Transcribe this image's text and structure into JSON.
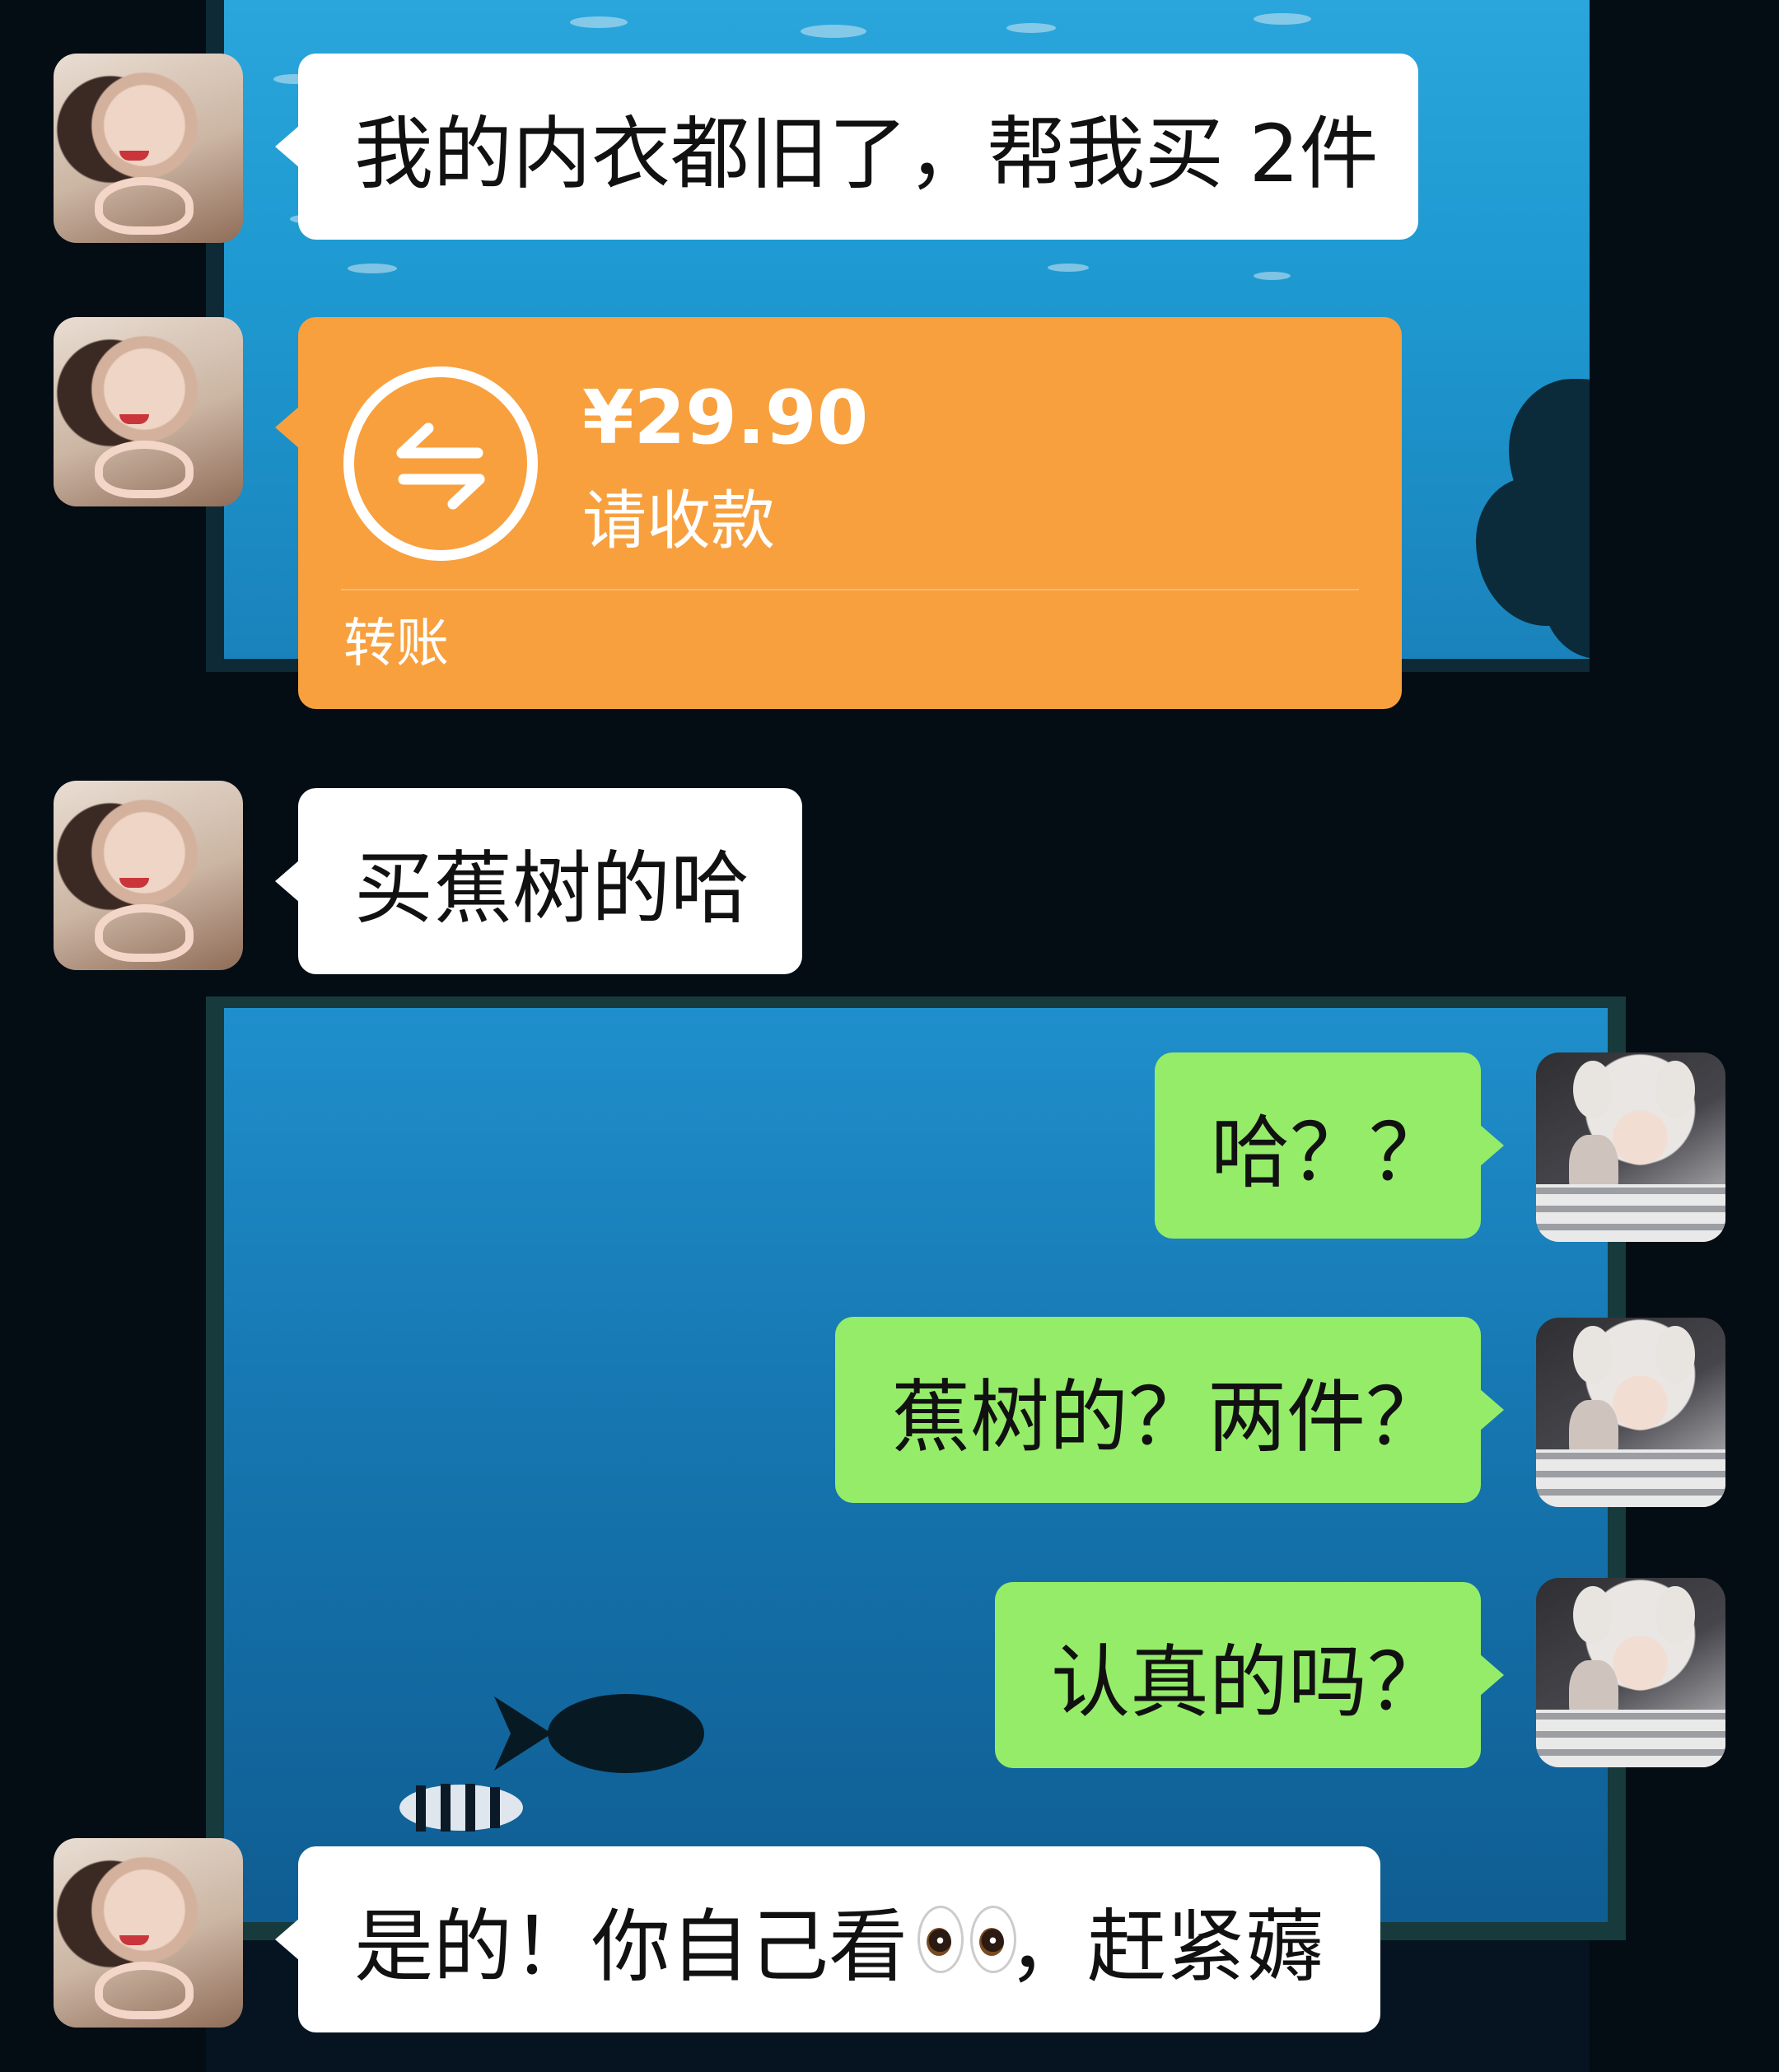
{
  "messages": [
    {
      "id": "m1",
      "side": "left",
      "text": "我的内衣都旧了，帮我买 2件"
    },
    {
      "id": "m2",
      "side": "left",
      "type": "transfer"
    },
    {
      "id": "m3",
      "side": "left",
      "text": "买蕉树的哈"
    },
    {
      "id": "m4",
      "side": "right",
      "text": "哈？？"
    },
    {
      "id": "m5",
      "side": "right",
      "text": "蕉树的？两件？"
    },
    {
      "id": "m6",
      "side": "right",
      "text": "认真的吗？"
    },
    {
      "id": "m7",
      "side": "left",
      "text_before": "是的！你自己看",
      "emoji": "eyes-emoji",
      "text_after": "，赶紧薅"
    }
  ],
  "transfer": {
    "amount": "¥29.90",
    "status": "请收款",
    "label": "转账",
    "icon": "transfer-arrows-icon",
    "color": "#f8a03e"
  },
  "colors": {
    "incoming_bubble": "#ffffff",
    "outgoing_bubble": "#95ec69",
    "background": "#061421"
  }
}
